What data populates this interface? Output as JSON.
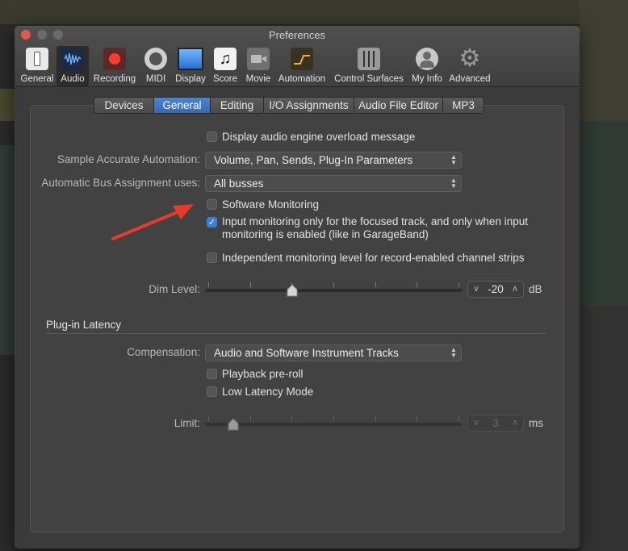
{
  "window": {
    "title": "Preferences"
  },
  "toolbar": {
    "items": [
      {
        "label": "General",
        "icon": "general-switch-icon"
      },
      {
        "label": "Audio",
        "icon": "audio-waveform-icon"
      },
      {
        "label": "Recording",
        "icon": "record-icon"
      },
      {
        "label": "MIDI",
        "icon": "midi-connector-icon"
      },
      {
        "label": "Display",
        "icon": "display-monitor-icon"
      },
      {
        "label": "Score",
        "icon": "music-note-icon"
      },
      {
        "label": "Movie",
        "icon": "movie-camera-icon"
      },
      {
        "label": "Automation",
        "icon": "automation-curve-icon"
      },
      {
        "label": "Control Surfaces",
        "icon": "fader-icon"
      },
      {
        "label": "My Info",
        "icon": "user-silhouette-icon"
      },
      {
        "label": "Advanced",
        "icon": "gear-icon"
      }
    ],
    "active": "Audio"
  },
  "tabs": {
    "items": [
      "Devices",
      "General",
      "Editing",
      "I/O Assignments",
      "Audio File Editor",
      "MP3"
    ],
    "active": "General"
  },
  "general": {
    "display_overload": {
      "label": "Display audio engine overload message",
      "checked": false
    },
    "sample_accurate": {
      "label": "Sample Accurate Automation:",
      "value": "Volume, Pan, Sends, Plug-In Parameters"
    },
    "bus_assignment": {
      "label": "Automatic Bus Assignment uses:",
      "value": "All busses"
    },
    "software_monitoring": {
      "label": "Software Monitoring",
      "checked": false
    },
    "input_monitoring": {
      "line1": "Input monitoring only for the focused track, and only when input",
      "line2": "monitoring is enabled (like in GarageBand)",
      "checked": true
    },
    "independent_monitoring": {
      "label": "Independent monitoring level for record-enabled channel strips",
      "checked": false
    },
    "dim_level": {
      "label": "Dim Level:",
      "value": "-20",
      "unit": "dB",
      "level_fraction": 0.34
    }
  },
  "plugin_latency": {
    "title": "Plug-in Latency",
    "compensation": {
      "label": "Compensation:",
      "value": "Audio and Software Instrument Tracks"
    },
    "playback_preroll": {
      "label": "Playback pre-roll",
      "checked": false
    },
    "low_latency": {
      "label": "Low Latency Mode",
      "checked": false
    },
    "limit": {
      "label": "Limit:",
      "value": "3",
      "unit": "ms",
      "level_fraction": 0.11
    }
  },
  "colors": {
    "accent": "#3c7de0",
    "annotation_arrow": "#e8392b",
    "window_bg": "#3b3b3b"
  },
  "glyphs": {
    "checkmark": "✓",
    "chevron_left": "‹",
    "chevron_right": "›",
    "popup_up": "▲",
    "popup_down": "▼"
  }
}
